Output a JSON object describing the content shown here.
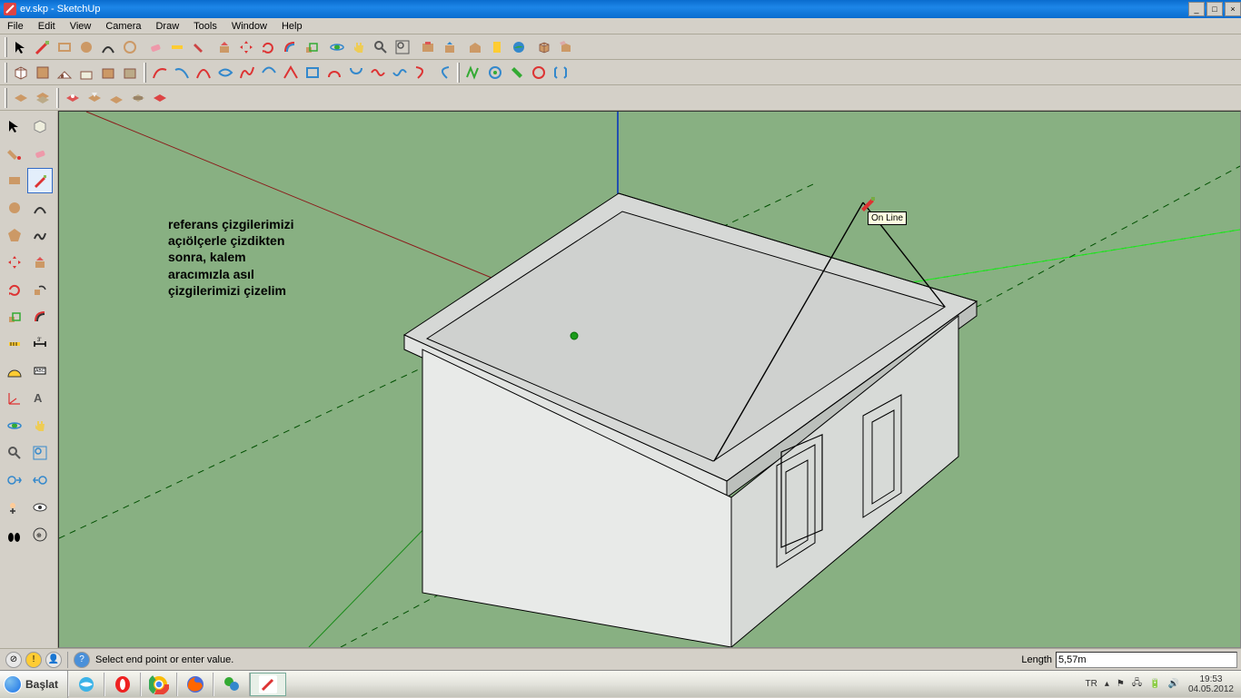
{
  "title": "ev.skp - SketchUp",
  "menu": {
    "items": [
      "File",
      "Edit",
      "View",
      "Camera",
      "Draw",
      "Tools",
      "Window",
      "Help"
    ]
  },
  "note_lines": [
    "referans çizgilerimizi",
    "açıölçerle çizdikten",
    "sonra, kalem",
    "aracımızla asıl",
    "çizgilerimizi çizelim"
  ],
  "tooltip": "On Line",
  "status": {
    "prompt": "Select end point or enter value.",
    "length_label": "Length",
    "length_value": "5,57m"
  },
  "taskbar": {
    "start_label": "Başlat",
    "lang": "TR",
    "time": "19:53",
    "date": "04.05.2012"
  },
  "win_buttons": {
    "min": "_",
    "max": "□",
    "close": "×"
  }
}
